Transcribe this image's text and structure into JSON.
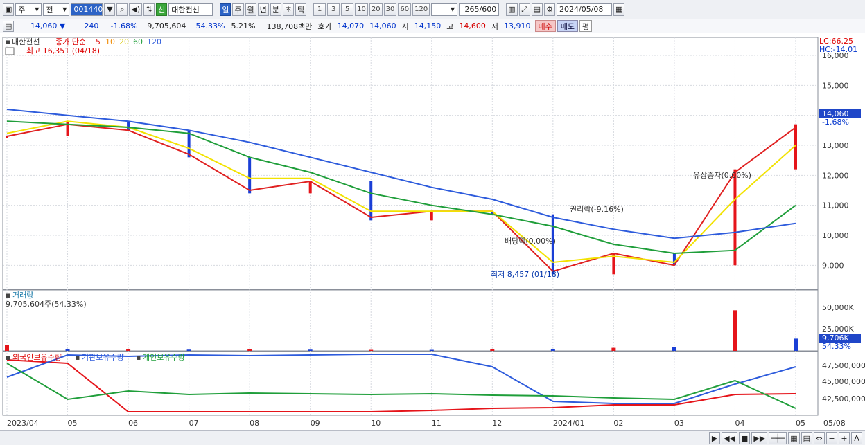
{
  "toolbar": {
    "type_select": "주",
    "scope_select": "전",
    "stock_code": "001440",
    "badge_new": "신",
    "stock_name": "대한전선",
    "periods": [
      "일",
      "주",
      "월",
      "년",
      "분",
      "초",
      "틱"
    ],
    "active_period": "일",
    "minute_buttons": [
      "1",
      "3",
      "5",
      "10",
      "20",
      "30",
      "60",
      "120"
    ],
    "count": "265",
    "count_max": "/600",
    "date": "2024/05/08"
  },
  "quote": {
    "price": "14,060",
    "change": "240",
    "change_pct": "-1.68%",
    "volume": "9,705,604",
    "volume_pct": "54.33%",
    "turnover_pct": "5.21%",
    "amount": "138,708백만",
    "ask_label": "호가",
    "ask": "14,070",
    "bid": "14,060",
    "open_label": "시",
    "open": "14,150",
    "high_label": "고",
    "high": "14,600",
    "low_label": "저",
    "low": "13,910",
    "buy_label": "매수",
    "sell_label": "매도",
    "flat_label": "평"
  },
  "price_panel": {
    "legend_name": "대한전선",
    "legend_ma": "종가 단순",
    "ma_periods": [
      "5",
      "10",
      "20",
      "60",
      "120"
    ],
    "max_label": "최고 16,351 (04/18)",
    "min_label": "최저 8,457 (01/18)",
    "annotations": [
      "유상증자(0.00%)",
      "권리락(-9.16%)",
      "배당락(0.00%)"
    ],
    "y_ticks": [
      "16,000",
      "15,000",
      "14,000",
      "13,000",
      "12,000",
      "11,000",
      "10,000",
      "9,000"
    ],
    "lc": "LC:66.25",
    "hc": "HC:-14.01",
    "current_price_tag": "14,060",
    "current_pct_tag": "-1.68%"
  },
  "volume_panel": {
    "title": "거래량",
    "value": "9,705,604주(54.33%)",
    "y_ticks": [
      "50,000K",
      "25,000K"
    ],
    "current_tag": "9,706K",
    "current_pct": "54.33%"
  },
  "holding_panel": {
    "legend": [
      "외국인보유수량",
      "기관보유수량",
      "개인보유수량"
    ],
    "y_ticks": [
      "47,500,000",
      "45,000,000",
      "42,500,000"
    ]
  },
  "x_axis": [
    "2023/04",
    "05",
    "06",
    "07",
    "08",
    "09",
    "10",
    "11",
    "12",
    "2024/01",
    "02",
    "03",
    "04",
    "05",
    "05/08"
  ],
  "colors": {
    "up": "#e5141a",
    "down": "#1a3fd6",
    "ma5": "#e02020",
    "ma10": "#f08a00",
    "ma20": "#f2e200",
    "ma60": "#1f9e3a",
    "ma120": "#2d5bdc"
  },
  "chart_data": [
    {
      "type": "line",
      "title": "대한전선",
      "x": [
        "2023/04",
        "05",
        "06",
        "07",
        "08",
        "09",
        "10",
        "11",
        "12",
        "2024/01",
        "02",
        "03",
        "04",
        "05"
      ],
      "series": [
        {
          "name": "종가",
          "values": [
            13300,
            13800,
            13500,
            12600,
            11400,
            11800,
            10500,
            10800,
            10700,
            8700,
            9400,
            9000,
            12200,
            13700
          ]
        },
        {
          "name": "5",
          "values": [
            13300,
            13700,
            13500,
            12700,
            11500,
            11800,
            10600,
            10800,
            10800,
            8800,
            9400,
            9000,
            12100,
            13600
          ]
        },
        {
          "name": "20",
          "values": [
            13400,
            13800,
            13600,
            12900,
            11900,
            11900,
            10800,
            10800,
            10800,
            9100,
            9300,
            9100,
            11200,
            13000
          ]
        },
        {
          "name": "60",
          "values": [
            13800,
            13700,
            13600,
            13400,
            12600,
            12100,
            11400,
            11000,
            10700,
            10300,
            9700,
            9400,
            9500,
            11000
          ]
        },
        {
          "name": "120",
          "values": [
            14200,
            14000,
            13800,
            13500,
            13100,
            12600,
            12100,
            11600,
            11200,
            10600,
            10200,
            9900,
            10100,
            10400
          ]
        }
      ],
      "ylim": [
        8200,
        16600
      ]
    },
    {
      "type": "bar",
      "title": "거래량",
      "x": [
        "2023/04",
        "05",
        "06",
        "07",
        "08",
        "09",
        "10",
        "11",
        "12",
        "2024/01",
        "02",
        "03",
        "04",
        "05"
      ],
      "values": [
        6000,
        2000,
        1500,
        1200,
        1500,
        1200,
        1000,
        1000,
        1500,
        2000,
        3000,
        3500,
        40000,
        12000
      ],
      "ylim": [
        0,
        60000
      ]
    },
    {
      "type": "line",
      "x": [
        "2023/04",
        "05",
        "06",
        "07",
        "08",
        "09",
        "10",
        "11",
        "12",
        "2024/01",
        "02",
        "03",
        "04",
        "05"
      ],
      "series": [
        {
          "name": "외국인보유수량",
          "values": [
            47500000,
            47000000,
            40000000,
            40000000,
            40000000,
            40000000,
            40000000,
            40200000,
            40500000,
            40600000,
            41000000,
            41000000,
            42500000,
            42600000
          ]
        },
        {
          "name": "기관보유수량",
          "values": [
            45000000,
            48200000,
            48000000,
            48200000,
            48100000,
            48200000,
            48300000,
            48300000,
            46500000,
            41500000,
            41200000,
            41200000,
            44000000,
            46500000
          ]
        },
        {
          "name": "개인보유수량",
          "values": [
            47000000,
            41800000,
            43000000,
            42500000,
            42700000,
            42600000,
            42500000,
            42600000,
            42400000,
            42300000,
            42000000,
            41800000,
            44500000,
            40500000
          ]
        }
      ],
      "ylim": [
        39500000,
        48500000
      ]
    }
  ]
}
